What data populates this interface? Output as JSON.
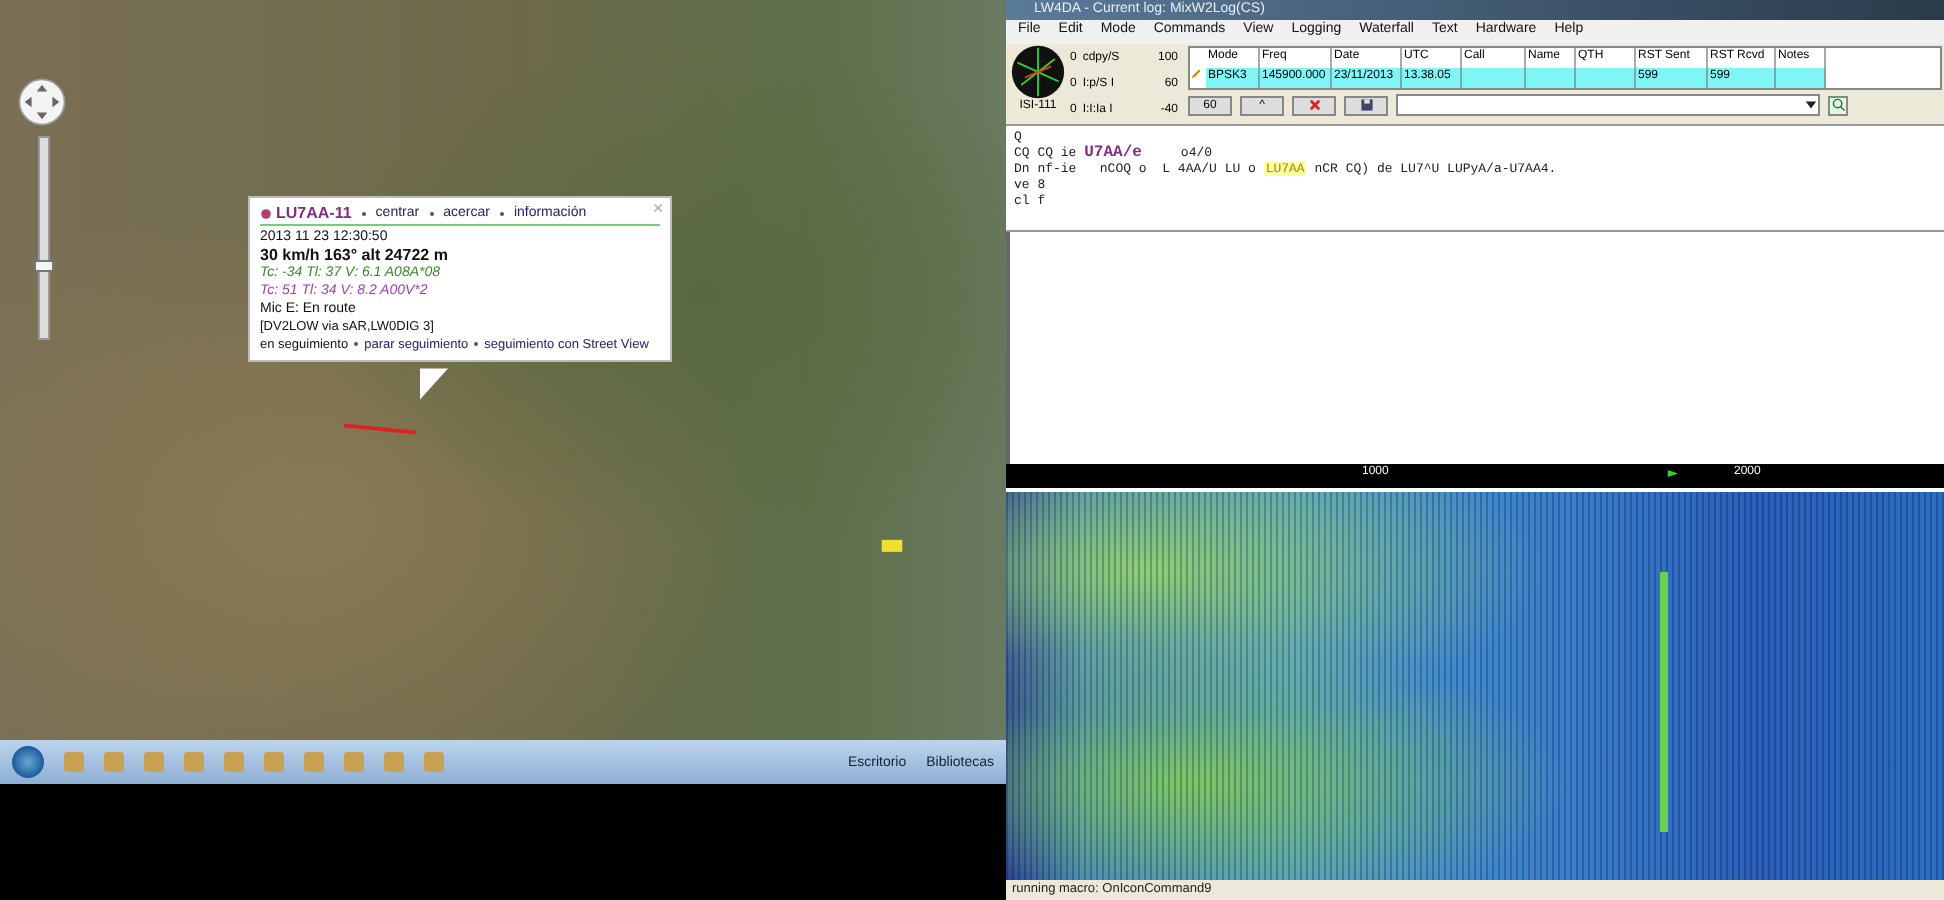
{
  "map": {
    "zoom": {
      "level": 0.35
    },
    "popup": {
      "callsign": "LU7AA-11",
      "links": [
        "centrar",
        "acercar",
        "información"
      ],
      "timestamp": "2013 11 23 12:30:50",
      "speed": "30 km/h 163° alt 24722 m",
      "telemetry": [
        {
          "text": "Tc: -34 Tl: 37 V: 6.1 A08A*08",
          "color": "#3a8a2a"
        },
        {
          "text": "Tc: 51 Tl: 34 V: 8.2 A00V*2",
          "color": "#a040b0"
        }
      ],
      "status": "Mic E: En route",
      "path": "[DV2LOW via sAR,LW0DIG 3]",
      "tracking": [
        {
          "text": "en seguimiento",
          "link": false
        },
        {
          "text": "parar seguimiento",
          "link": true
        },
        {
          "text": "seguimiento con Street View",
          "link": true
        }
      ]
    }
  },
  "taskbar": {
    "items": [
      "Escritorio",
      "Bibliotecas"
    ]
  },
  "app": {
    "title": "LW4DA - Current log: MixW2Log(CS)",
    "menu": [
      "File",
      "Edit",
      "Mode",
      "Commands",
      "View",
      "Logging",
      "Waterfall",
      "Text",
      "Hardware",
      "Help"
    ],
    "meters": [
      {
        "low": "0",
        "label": "cdpy/S",
        "high": "100"
      },
      {
        "low": "0",
        "label": "I:p/S I",
        "high": "60"
      },
      {
        "low": "0",
        "label": "I:I:Ia I",
        "high": "-40"
      }
    ],
    "scope_label": "ISI-111",
    "log": {
      "columns": [
        "Mode",
        "Freq",
        "Date",
        "UTC",
        "Call",
        "Name",
        "QTH",
        "RST Sent",
        "RST Rcvd",
        "Notes"
      ],
      "row": {
        "mode": "BPSK3",
        "freq": "145900.000",
        "date": "23/11/2013",
        "utc": "13.38.05",
        "rst_sent": "599",
        "rst_rcvd": "599"
      }
    },
    "toolbar": {
      "first_button": "60",
      "second_button": "^"
    },
    "receive": [
      [
        {
          "text": "Q",
          "kind": "plain"
        }
      ],
      [
        {
          "text": "CQ CQ ie ",
          "kind": "plain"
        },
        {
          "text": "U7AA/e",
          "kind": "call"
        },
        {
          "text": "     o4/0",
          "kind": "plain"
        }
      ],
      [
        {
          "text": "Dn nf-ie   nCOQ o  L 4AA/U LU o ",
          "kind": "plain"
        },
        {
          "text": "LU7AA",
          "kind": "highlight"
        },
        {
          "text": " nCR CQ) de LU7^U LUPyA/a-U7AA4.",
          "kind": "plain"
        }
      ],
      [
        {
          "text": "ve 8",
          "kind": "plain"
        }
      ],
      [
        {
          "text": "cl f",
          "kind": "plain"
        }
      ]
    ],
    "scale": [
      "1000",
      "2000"
    ],
    "status": "running macro: OnIconCommand9"
  }
}
